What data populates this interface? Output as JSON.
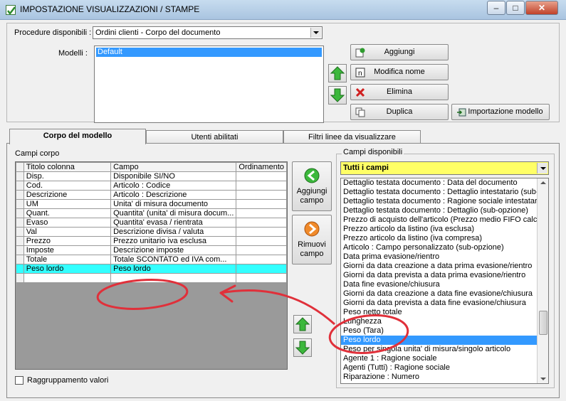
{
  "window": {
    "title": "IMPOSTAZIONE VISUALIZZAZIONI / STAMPE",
    "minimize": "‒",
    "maximize": "□",
    "close": "✕"
  },
  "procedure": {
    "label": "Procedure disponibili :",
    "value": "Ordini clienti - Corpo del documento"
  },
  "modelli": {
    "label": "Modelli :",
    "items": [
      "Default"
    ]
  },
  "buttons": {
    "aggiungi": "Aggiungi",
    "modifica_nome": "Modifica nome",
    "elimina": "Elimina",
    "duplica": "Duplica",
    "importazione": "Importazione modello"
  },
  "tabs": [
    {
      "label": "Corpo del modello",
      "active": true
    },
    {
      "label": "Utenti abilitati",
      "active": false
    },
    {
      "label": "Filtri linee da visualizzare",
      "active": false
    }
  ],
  "campi_corpo": {
    "label": "Campi corpo",
    "columns": [
      "Titolo colonna",
      "Campo",
      "Ordinamento"
    ],
    "rows": [
      {
        "titolo": "Disp.",
        "campo": "Disponibile SI/NO",
        "ord": ""
      },
      {
        "titolo": "Cod.",
        "campo": "Articolo : Codice",
        "ord": ""
      },
      {
        "titolo": "Descrizione",
        "campo": "Articolo : Descrizione",
        "ord": ""
      },
      {
        "titolo": "UM",
        "campo": "Unita' di misura documento",
        "ord": ""
      },
      {
        "titolo": "Quant.",
        "campo": "Quantita' (unita' di misura docum...",
        "ord": ""
      },
      {
        "titolo": "Evaso",
        "campo": "Quantita' evasa / rientrata",
        "ord": ""
      },
      {
        "titolo": "Val",
        "campo": "Descrizione divisa / valuta",
        "ord": ""
      },
      {
        "titolo": "Prezzo",
        "campo": "Prezzo unitario iva esclusa",
        "ord": ""
      },
      {
        "titolo": "Imposte",
        "campo": "Descrizione imposte",
        "ord": ""
      },
      {
        "titolo": "Totale",
        "campo": "Totale SCONTATO ed IVA com...",
        "ord": ""
      },
      {
        "titolo": "Peso lordo",
        "campo": "Peso lordo",
        "ord": ""
      },
      {
        "titolo": "",
        "campo": "",
        "ord": ""
      }
    ]
  },
  "middle_buttons": {
    "aggiungi_campo": "Aggiungi campo",
    "rimuovi_campo": "Rimuovi campo"
  },
  "campi_disponibili": {
    "label": "Campi disponibili",
    "filter": "Tutti i campi",
    "items": [
      "Dettaglio testata documento : Data del documento",
      "Dettaglio testata documento : Dettaglio intestatario (sub-op",
      "Dettaglio testata documento : Ragione sociale intestatario",
      "Dettaglio testata documento : Dettaglio (sub-opzione)",
      "Prezzo di acquisto dell'articolo (Prezzo medio FIFO calcola",
      "Prezzo articolo da listino (iva esclusa)",
      "Prezzo articolo da listino (iva compresa)",
      "Articolo : Campo personalizzato (sub-opzione)",
      "Data prima evasione/rientro",
      "Giorni da data creazione a data prima evasione/rientro",
      "Giorni da data prevista a data prima evasione/rientro",
      "Data fine evasione/chiusura",
      "Giorni da data creazione a data fine evasione/chiusura",
      "Giorni da data prevista a data fine evasione/chiusura",
      "Peso netto totale",
      "Lunghezza",
      "Peso (Tara)",
      "Peso lordo",
      "Peso per singola unita' di misura/singolo articolo",
      "Agente 1 : Ragione sociale",
      "Agenti (Tutti) : Ragione sociale",
      "Riparazione : Numero"
    ],
    "selected_index": 17
  },
  "raggruppamento": {
    "label": "Raggruppamento valori",
    "checked": false
  },
  "colors": {
    "highlight_row": "#33ffff",
    "list_selection": "#3399ff",
    "filter_combo": "#ffff66",
    "annotation": "#e0303a"
  }
}
